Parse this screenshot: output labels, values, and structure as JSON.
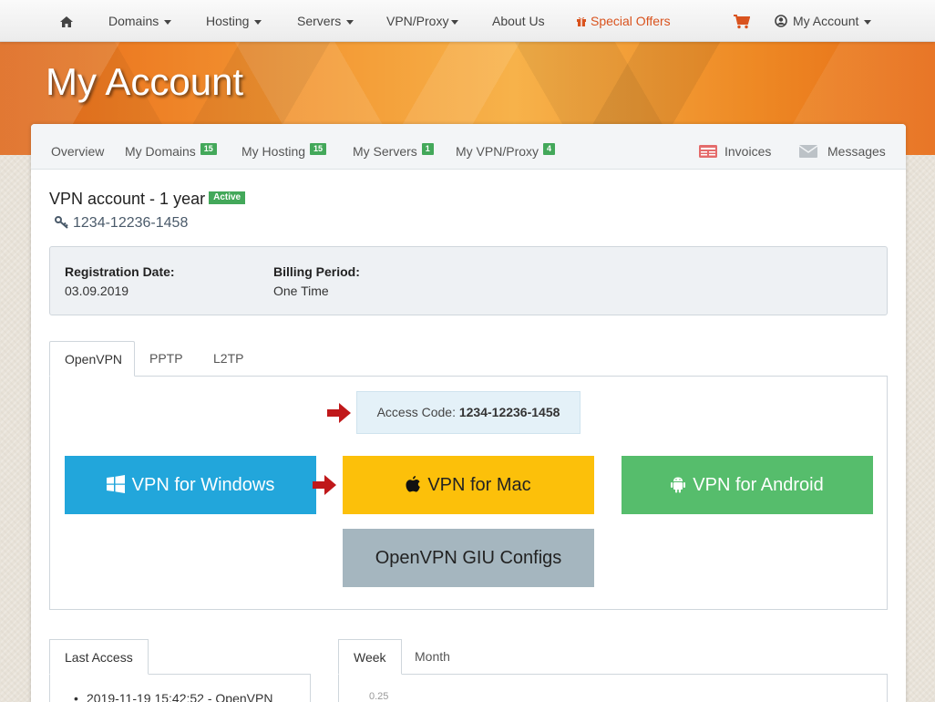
{
  "nav": {
    "home_icon": "home-icon",
    "items": [
      {
        "label": "Domains"
      },
      {
        "label": "Hosting"
      },
      {
        "label": "Servers"
      },
      {
        "label": "VPN/Proxy"
      },
      {
        "label": "About Us"
      }
    ],
    "special": "Special Offers",
    "cart_icon": "cart-icon",
    "account": "My Account"
  },
  "hero": {
    "title": "My Account"
  },
  "subnav": {
    "items": [
      {
        "label": "Overview"
      },
      {
        "label": "My Domains",
        "badge": "15"
      },
      {
        "label": "My Hosting",
        "badge": "15"
      },
      {
        "label": "My Servers",
        "badge": "1"
      },
      {
        "label": "My VPN/Proxy",
        "badge": "4"
      }
    ],
    "invoices": "Invoices",
    "messages": "Messages"
  },
  "account": {
    "title": "VPN account - 1 year",
    "status": "Active",
    "id": "1234-12236-1458"
  },
  "info": {
    "registration_label": "Registration Date:",
    "registration_value": "03.09.2019",
    "billing_label": "Billing Period:",
    "billing_value": "One Time"
  },
  "tabs": [
    {
      "label": "OpenVPN",
      "active": true
    },
    {
      "label": "PPTP"
    },
    {
      "label": "L2TP"
    }
  ],
  "openvpn": {
    "access_label": "Access Code: ",
    "access_code": "1234-12236-1458",
    "buttons": {
      "windows": "VPN for Windows",
      "mac": "VPN for Mac",
      "android": "VPN for Android",
      "configs": "OpenVPN GIU Configs"
    }
  },
  "last_access": {
    "tab": "Last Access",
    "entries": [
      "2019-11-19 15:42:52 - OpenVPN"
    ]
  },
  "stats": {
    "tabs": [
      {
        "label": "Week",
        "active": true
      },
      {
        "label": "Month"
      }
    ],
    "y_tick": "0.25"
  },
  "colors": {
    "accent_orange": "#d9531e",
    "badge_green": "#43a85a",
    "windows_blue": "#22a6db",
    "mac_yellow": "#fcc00a",
    "android_green": "#56bd6c",
    "config_gray": "#a5b6bf",
    "arrow_red": "#c0181a"
  }
}
